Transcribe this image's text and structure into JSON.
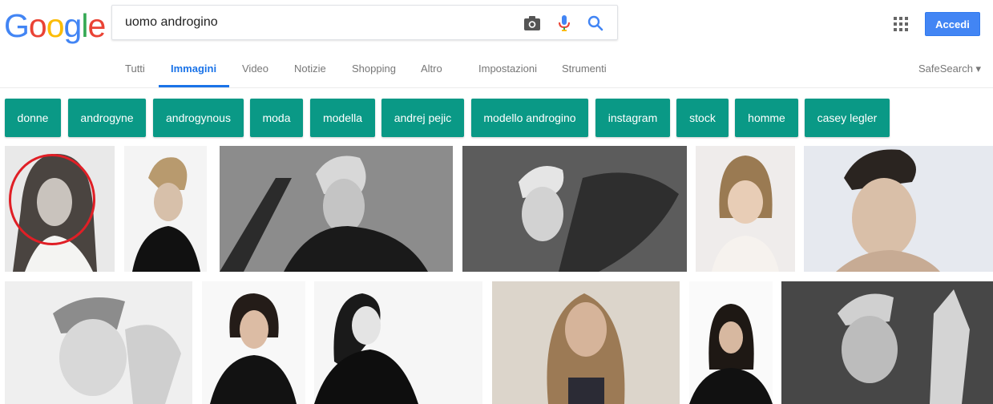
{
  "logo": {
    "letters": [
      "G",
      "o",
      "o",
      "g",
      "l",
      "e"
    ],
    "colors": [
      "#4285f4",
      "#ea4335",
      "#fbbc05",
      "#4285f4",
      "#34a853",
      "#ea4335"
    ]
  },
  "search": {
    "query": "uomo androgino"
  },
  "header": {
    "signin_label": "Accedi"
  },
  "tabs": [
    {
      "label": "Tutti",
      "active": false
    },
    {
      "label": "Immagini",
      "active": true
    },
    {
      "label": "Video",
      "active": false
    },
    {
      "label": "Notizie",
      "active": false
    },
    {
      "label": "Shopping",
      "active": false
    },
    {
      "label": "Altro",
      "active": false
    }
  ],
  "tools": [
    {
      "label": "Impostazioni"
    },
    {
      "label": "Strumenti"
    }
  ],
  "safesearch": {
    "label": "SafeSearch ▾"
  },
  "chips": [
    "donne",
    "androgyne",
    "androgynous",
    "moda",
    "modella",
    "andrej pejic",
    "modello androgino",
    "instagram",
    "stock",
    "homme",
    "casey legler"
  ],
  "colors": {
    "accent": "#1a73e8",
    "chip": "#0a9986",
    "signin": "#4285f4",
    "highlight": "#e01f26"
  }
}
